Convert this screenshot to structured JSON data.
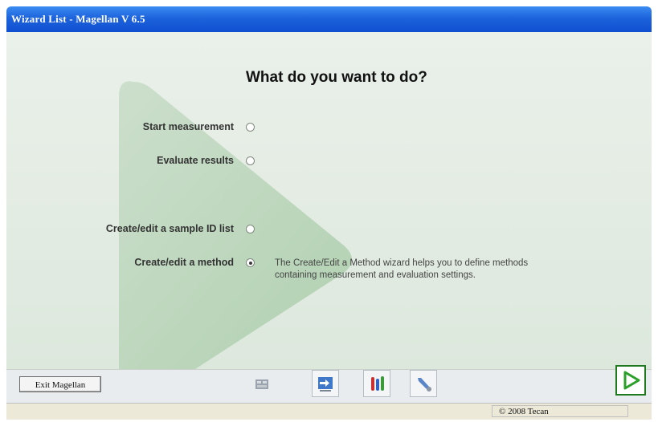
{
  "window": {
    "title": "Wizard List - Magellan V 6.5"
  },
  "main": {
    "heading": "What do you want to do?",
    "options": [
      {
        "label": "Start measurement",
        "selected": false
      },
      {
        "label": "Evaluate results",
        "selected": false
      },
      {
        "label": "Create/edit a sample ID list",
        "selected": false
      },
      {
        "label": "Create/edit a method",
        "selected": true
      }
    ],
    "description": "The Create/Edit a Method wizard helps you to define methods containing measurement and evaluation settings."
  },
  "toolbar": {
    "exit_label": "Exit Magellan",
    "icons": [
      "measure-icon",
      "transfer-icon",
      "tubes-icon",
      "tools-icon"
    ],
    "next_icon": "play-arrow-icon"
  },
  "status": {
    "copyright": "© 2008 Tecan"
  },
  "colors": {
    "title_bar": "#1d63dc",
    "background": "#dde8dd",
    "next_arrow": "#2aa02a"
  }
}
